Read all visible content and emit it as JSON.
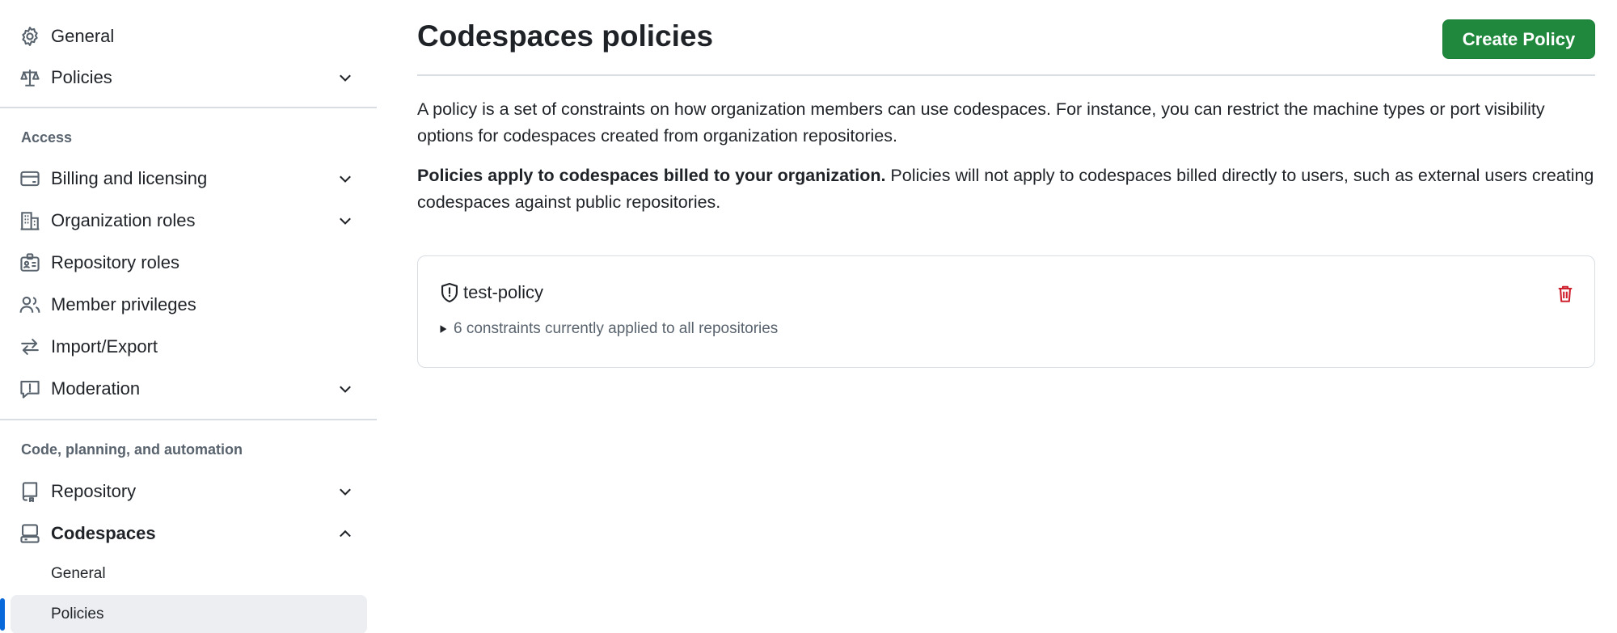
{
  "sidebar": {
    "general_label": "General",
    "policies_label": "Policies",
    "access_heading": "Access",
    "billing_label": "Billing and licensing",
    "org_roles_label": "Organization roles",
    "repo_roles_label": "Repository roles",
    "member_privileges_label": "Member privileges",
    "import_export_label": "Import/Export",
    "moderation_label": "Moderation",
    "code_heading": "Code, planning, and automation",
    "repository_label": "Repository",
    "codespaces_label": "Codespaces",
    "codespaces_sub": {
      "general_label": "General",
      "policies_label": "Policies"
    }
  },
  "main": {
    "title": "Codespaces policies",
    "create_button_label": "Create Policy",
    "intro_text": "A policy is a set of constraints on how organization members can use codespaces. For instance, you can restrict the machine types or port visibility options for codespaces created from organization repositories.",
    "billing_bold": "Policies apply to codespaces billed to your organization.",
    "billing_text": " Policies will not apply to codespaces billed directly to users, such as external users creating codespaces against public repositories.",
    "policy": {
      "name": "test-policy",
      "summary": "6 constraints currently applied to all repositories"
    }
  },
  "colors": {
    "accent_blue": "#0969da",
    "button_green": "#1f883d",
    "danger_red": "#cf222e",
    "muted_text": "#59636e",
    "border": "#d8dee4"
  },
  "icons": {
    "general": "gear-icon",
    "policies": "law-icon",
    "billing": "credit-card-icon",
    "org_roles": "organization-icon",
    "repo_roles": "id-badge-icon",
    "member_privileges": "people-icon",
    "import_export": "arrow-switch-icon",
    "moderation": "report-icon",
    "repository": "repo-icon",
    "codespaces": "codespaces-icon",
    "policy": "shield-icon",
    "delete": "trash-icon"
  }
}
